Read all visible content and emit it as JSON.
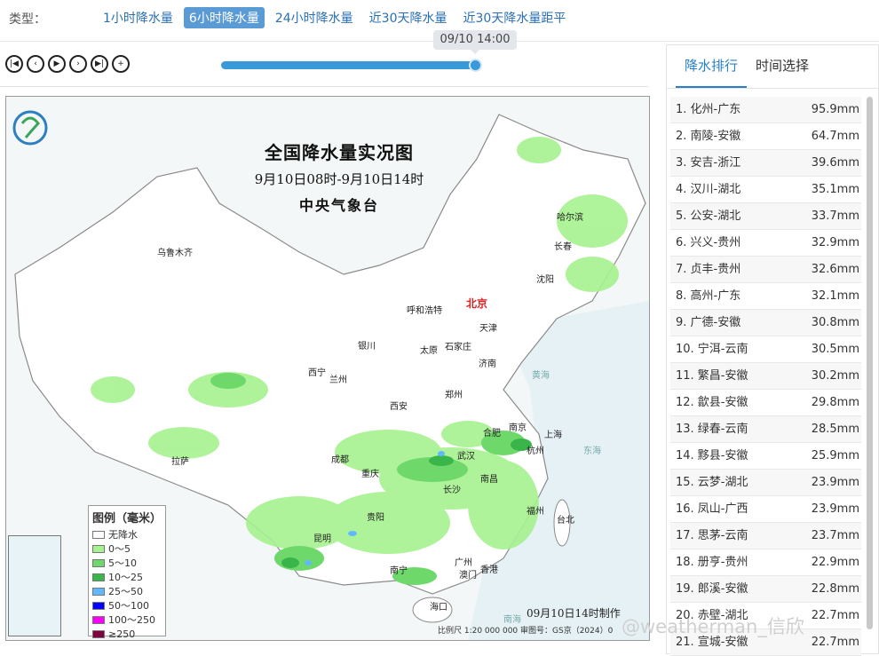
{
  "header": {
    "type_label": "类型：",
    "tabs": [
      "1小时降水量",
      "6小时降水量",
      "24小时降水量",
      "近30天降水量",
      "近30天降水量距平"
    ],
    "active_tab": 1
  },
  "player": {
    "time_tooltip": "09/10 14:00",
    "progress": 1.0,
    "controls": [
      "first-frame-icon",
      "prev-icon",
      "play-icon",
      "next-icon",
      "last-frame-icon",
      "zoom-in-icon"
    ]
  },
  "map": {
    "title": "全国降水量实况图",
    "period": "9月10日08时-9月10日14时",
    "agency": "中央气象台",
    "made_time": "09月10日14时制作",
    "scale": "比例尺 1:20 000 000    审图号：GS京（2024）0",
    "capital": "北京",
    "cities": [
      "乌鲁木齐",
      "哈尔滨",
      "长春",
      "沈阳",
      "呼和浩特",
      "天津",
      "银川",
      "太原",
      "石家庄",
      "济南",
      "西宁",
      "兰州",
      "郑州",
      "西安",
      "合肥",
      "南京",
      "上海",
      "武汉",
      "杭州",
      "成都",
      "拉萨",
      "重庆",
      "长沙",
      "南昌",
      "福州",
      "台北",
      "贵阳",
      "昆明",
      "南宁",
      "广州",
      "澳门",
      "香港",
      "海口"
    ],
    "sea_labels": [
      "黄海",
      "东海",
      "南海"
    ],
    "legend": {
      "title": "图例（毫米）",
      "items": [
        {
          "label": "无降水",
          "color": "#ffffff"
        },
        {
          "label": "0～5",
          "color": "#a6f28f"
        },
        {
          "label": "5～10",
          "color": "#6ed96a"
        },
        {
          "label": "10～25",
          "color": "#3ab54a"
        },
        {
          "label": "25～50",
          "color": "#61b8ff"
        },
        {
          "label": "50～100",
          "color": "#0000ff"
        },
        {
          "label": "100～250",
          "color": "#fa00fa"
        },
        {
          "label": "≥250",
          "color": "#800040"
        }
      ]
    }
  },
  "sidebar": {
    "tabs": [
      "降水排行",
      "时间选择"
    ],
    "active_tab": 0,
    "ranking": [
      {
        "name": "1. 化州-广东",
        "value": "95.9mm"
      },
      {
        "name": "2. 南陵-安徽",
        "value": "64.7mm"
      },
      {
        "name": "3. 安吉-浙江",
        "value": "39.6mm"
      },
      {
        "name": "4. 汉川-湖北",
        "value": "35.1mm"
      },
      {
        "name": "5. 公安-湖北",
        "value": "33.7mm"
      },
      {
        "name": "6. 兴义-贵州",
        "value": "32.9mm"
      },
      {
        "name": "7. 贞丰-贵州",
        "value": "32.6mm"
      },
      {
        "name": "8. 高州-广东",
        "value": "32.1mm"
      },
      {
        "name": "9. 广德-安徽",
        "value": "30.8mm"
      },
      {
        "name": "10. 宁洱-云南",
        "value": "30.5mm"
      },
      {
        "name": "11. 繁昌-安徽",
        "value": "30.2mm"
      },
      {
        "name": "12. 歙县-安徽",
        "value": "29.8mm"
      },
      {
        "name": "13. 绿春-云南",
        "value": "28.5mm"
      },
      {
        "name": "14. 黟县-安徽",
        "value": "25.9mm"
      },
      {
        "name": "15. 云梦-湖北",
        "value": "23.9mm"
      },
      {
        "name": "16. 凤山-广西",
        "value": "23.9mm"
      },
      {
        "name": "17. 思茅-云南",
        "value": "23.7mm"
      },
      {
        "name": "18. 册亨-贵州",
        "value": "22.9mm"
      },
      {
        "name": "19. 郎溪-安徽",
        "value": "22.8mm"
      },
      {
        "name": "20. 赤壁-湖北",
        "value": "22.7mm"
      },
      {
        "name": "21. 宣城-安徽",
        "value": "22.7mm"
      }
    ]
  },
  "watermark": "@weatherman_信欣"
}
